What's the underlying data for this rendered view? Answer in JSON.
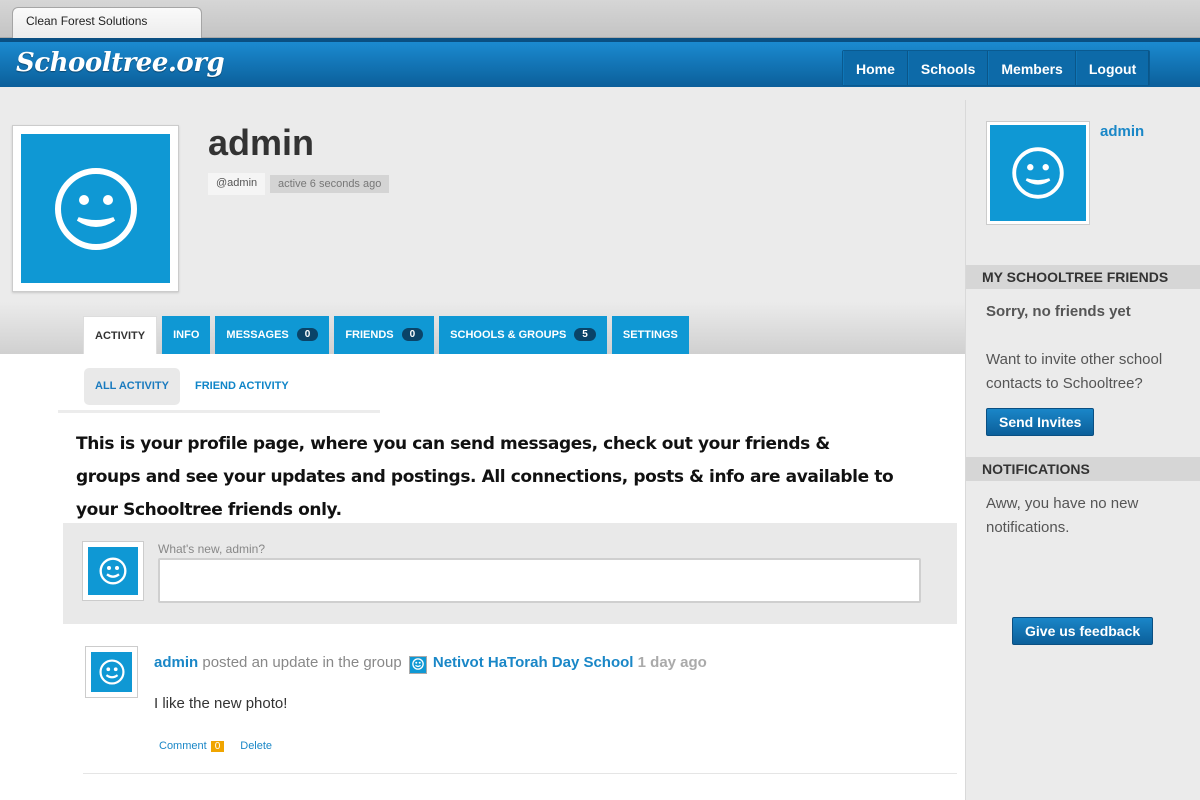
{
  "browser": {
    "tab_title": "Clean Forest Solutions"
  },
  "site": {
    "logo": "Schooltree.org",
    "nav": [
      "Home",
      "Schools",
      "Members",
      "Logout"
    ]
  },
  "profile": {
    "name": "admin",
    "handle": "@admin",
    "active": "active 6 seconds ago",
    "tabs": [
      {
        "label": "ACTIVITY"
      },
      {
        "label": "INFO"
      },
      {
        "label": "MESSAGES",
        "count": "0"
      },
      {
        "label": "FRIENDS",
        "count": "0"
      },
      {
        "label": "SCHOOLS & GROUPS",
        "count": "5"
      },
      {
        "label": "SETTINGS"
      }
    ],
    "subtabs": [
      "ALL ACTIVITY",
      "FRIEND ACTIVITY"
    ]
  },
  "intro": "This is your profile page, where you can send messages, check out your friends & groups and see your updates and postings. All connections, posts & info are available to your Schooltree friends only.",
  "whats_new": {
    "label": "What's new, admin?",
    "value": ""
  },
  "post": {
    "user": "admin",
    "action": "posted an update in the group",
    "group": "Netivot HaTorah Day School",
    "time": "1 day ago",
    "body": "I like the new photo!",
    "comment_label": "Comment",
    "comment_count": "0",
    "delete_label": "Delete"
  },
  "sidebar": {
    "user": "admin",
    "friends_heading": "MY SCHOOLTREE FRIENDS",
    "no_friends": "Sorry, no friends yet",
    "invite_text": "Want to invite other school contacts to Schooltree?",
    "invite_button": "Send Invites",
    "notifications_heading": "NOTIFICATIONS",
    "no_notifications": "Aww, you have no new notifications.",
    "feedback_button": "Give us feedback"
  },
  "colors": {
    "accent": "#0f98d4",
    "header": "#0b6aa8",
    "badge": "#f0a500"
  }
}
